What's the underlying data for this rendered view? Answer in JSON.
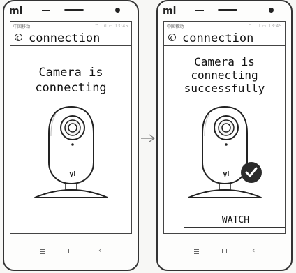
{
  "arrow_icon": "right-arrow-icon",
  "phones": [
    {
      "brand": "mi",
      "carrier": "中国移动",
      "status_icons": "⌔ ..ıl ▭ 13:45",
      "app_title": "connection",
      "message": "Camera is\nconnecting",
      "camera_model_label": "yi",
      "success_icon": null,
      "button_label": null
    },
    {
      "brand": "mi",
      "carrier": "中国移动",
      "status_icons": "⌔ ..ıl ▭ 13:45",
      "app_title": "connection",
      "message": "Camera is\nconnecting\nsuccessfully",
      "camera_model_label": "yi",
      "success_icon": "check-icon",
      "button_label": "WATCH"
    }
  ]
}
